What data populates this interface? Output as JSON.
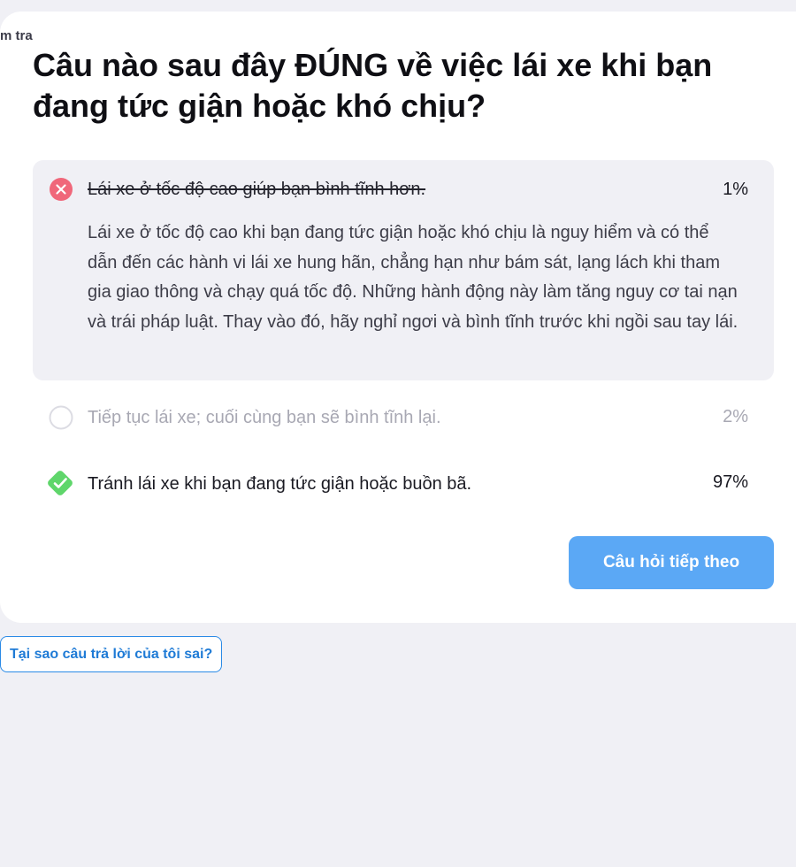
{
  "header": {
    "corner_label": "m tra"
  },
  "question": {
    "text": "Câu nào sau đây ĐÚNG về việc lái xe khi bạn đang tức giận hoặc khó chịu?"
  },
  "options": [
    {
      "text": "Lái xe ở tốc độ cao giúp bạn bình tĩnh hơn.",
      "percent": "1%",
      "state": "wrong-selected",
      "explanation": "Lái xe ở tốc độ cao khi bạn đang tức giận hoặc khó chịu là nguy hiểm và có thể dẫn đến các hành vi lái xe hung hãn, chẳng hạn như bám sát, lạng lách khi tham gia giao thông và chạy quá tốc độ. Những hành động này làm tăng nguy cơ tai nạn và trái pháp luật. Thay vào đó, hãy nghỉ ngơi và bình tĩnh trước khi ngồi sau tay lái."
    },
    {
      "text": "Tiếp tục lái xe; cuối cùng bạn sẽ bình tĩnh lại.",
      "percent": "2%",
      "state": "unselected"
    },
    {
      "text": "Tránh lái xe khi bạn đang tức giận hoặc buồn bã.",
      "percent": "97%",
      "state": "correct"
    }
  ],
  "buttons": {
    "next_question": "Câu hỏi tiếp theo",
    "why_wrong": "Tại sao câu trả lời của tôi sai?"
  },
  "colors": {
    "wrong": "#f0677a",
    "correct": "#5fd66b",
    "primary": "#5ba8f5",
    "link": "#1f7bd6"
  },
  "icons": {
    "wrong": "close-circle-icon",
    "unselected": "empty-circle-icon",
    "correct": "check-diamond-icon"
  }
}
